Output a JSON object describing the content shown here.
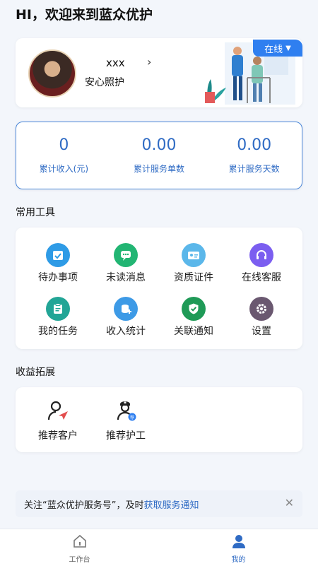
{
  "header": {
    "greeting": "HI，欢迎来到蓝众优护"
  },
  "profile": {
    "name": "xxx",
    "arrow": "›",
    "role": "安心照护",
    "status_label": "在线",
    "status_arrow": "▼"
  },
  "stats": [
    {
      "value": "0",
      "label": "累计收入(元)"
    },
    {
      "value": "0.00",
      "label": "累计服务单数"
    },
    {
      "value": "0.00",
      "label": "累计服务天数"
    }
  ],
  "tools": {
    "title": "常用工具",
    "items": [
      {
        "label": "待办事项",
        "icon": "calendar-check-icon",
        "color": "#2e9be6"
      },
      {
        "label": "未读消息",
        "icon": "chat-bubble-icon",
        "color": "#22b573"
      },
      {
        "label": "资质证件",
        "icon": "id-card-icon",
        "color": "#5bb7ea"
      },
      {
        "label": "在线客服",
        "icon": "headset-icon",
        "color": "#7b5ef0"
      },
      {
        "label": "我的任务",
        "icon": "clipboard-icon",
        "color": "#22a596"
      },
      {
        "label": "收入统计",
        "icon": "coins-stat-icon",
        "color": "#3d9ae6"
      },
      {
        "label": "关联通知",
        "icon": "shield-check-icon",
        "color": "#1f9a57"
      },
      {
        "label": "设置",
        "icon": "gear-icon",
        "color": "#6a5870"
      }
    ]
  },
  "earn": {
    "title": "收益拓展",
    "items": [
      {
        "label": "推荐客户",
        "icon": "refer-customer-icon"
      },
      {
        "label": "推荐护工",
        "icon": "refer-nurse-icon",
        "badge": "荐"
      }
    ]
  },
  "notice": {
    "text": "关注“蓝众优护服务号”，及时",
    "link": "获取服务通知",
    "close": "✕"
  },
  "tabbar": [
    {
      "label": "工作台",
      "icon": "home-icon"
    },
    {
      "label": "我的",
      "icon": "user-icon"
    }
  ]
}
